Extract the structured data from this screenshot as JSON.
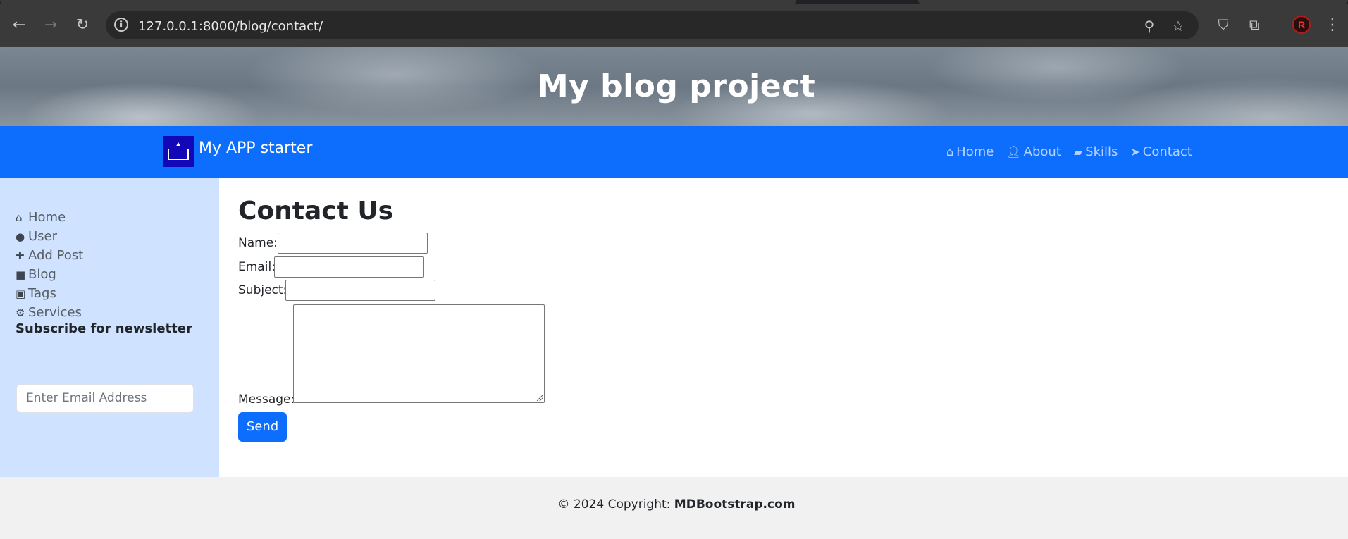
{
  "browser": {
    "url": "127.0.0.1:8000/blog/contact/",
    "back_icon": "back-arrow-icon",
    "forward_icon": "forward-arrow-icon",
    "reload_icon": "reload-icon",
    "zoom_icon": "zoom-icon",
    "bookmark_icon": "star-icon",
    "extension_icons": [
      "shield-extension-icon",
      "puzzle-extensions-icon"
    ],
    "profile_icon": "profile-avatar-icon",
    "menu_icon": "kebab-menu-icon"
  },
  "banner": {
    "title": "My blog project"
  },
  "topnav": {
    "brand": "My APP starter",
    "links": [
      {
        "label": "Home",
        "icon": "home-icon"
      },
      {
        "label": "About",
        "icon": "user-icon"
      },
      {
        "label": "Skills",
        "icon": "book-icon"
      },
      {
        "label": "Contact",
        "icon": "paper-plane-icon"
      }
    ]
  },
  "sidebar": {
    "items": [
      {
        "label": "Home",
        "icon": "home-icon"
      },
      {
        "label": "User",
        "icon": "user-icon"
      },
      {
        "label": "Add Post",
        "icon": "plus-icon"
      },
      {
        "label": "Blog",
        "icon": "sticky-note-icon"
      },
      {
        "label": "Tags",
        "icon": "briefcase-icon"
      },
      {
        "label": "Services",
        "icon": "gears-icon"
      }
    ],
    "newsletter": {
      "title": "Subscribe for newsletter",
      "placeholder": "Enter Email Address",
      "value": ""
    }
  },
  "contact": {
    "title": "Contact Us",
    "name_label": "Name:",
    "email_label": "Email:",
    "subject_label": "Subject:",
    "message_label": "Message:",
    "name_value": "",
    "email_value": "",
    "subject_value": "",
    "message_value": "",
    "send_label": "Send"
  },
  "footer": {
    "copyright": "© 2024 Copyright:",
    "link": "MDBootstrap.com"
  },
  "colors": {
    "primary": "#0d6efd",
    "sidebar_bg": "#cfe2ff",
    "nav_link": "#b7d2ff",
    "footer_bg": "#f1f1f1"
  }
}
